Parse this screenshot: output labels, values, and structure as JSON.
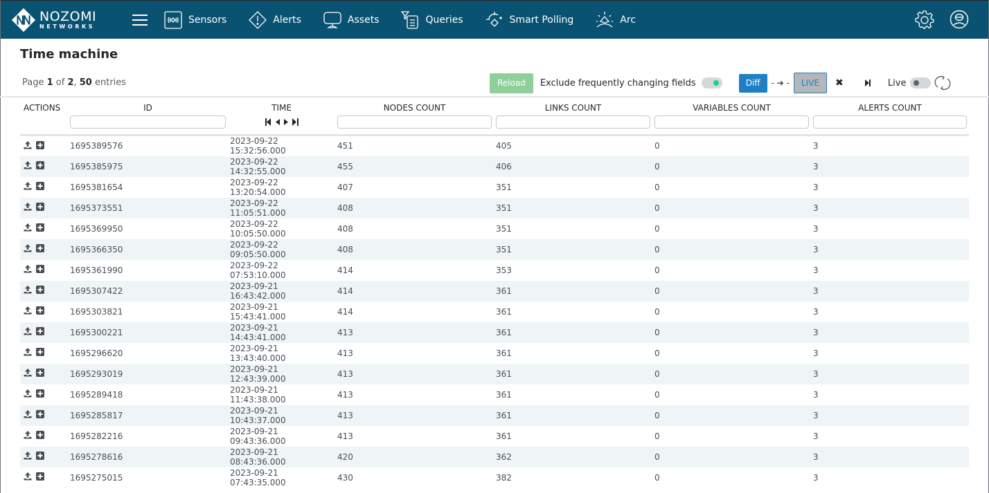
{
  "brand": {
    "name": "NOZOMI",
    "sub": "NETWORKS"
  },
  "nav": [
    {
      "label": "Sensors",
      "icon": "sensors-icon"
    },
    {
      "label": "Alerts",
      "icon": "alert-icon"
    },
    {
      "label": "Assets",
      "icon": "monitor-icon"
    },
    {
      "label": "Queries",
      "icon": "queries-icon"
    },
    {
      "label": "Smart Polling",
      "icon": "smart-polling-icon"
    },
    {
      "label": "Arc",
      "icon": "arc-icon"
    }
  ],
  "page": {
    "title": "Time machine",
    "page_prefix": "Page ",
    "page_current": "1",
    "page_of": " of ",
    "page_total": "2",
    "page_sep": ", ",
    "entries": "50",
    "entries_suffix": " entries"
  },
  "toolbar": {
    "reload_label": "Reload",
    "exclude_label": "Exclude frequently changing fields",
    "exclude_on": true,
    "diff_label": "Diff",
    "arrow_text": "- ➔ -",
    "live_button_label": "LIVE",
    "live_label": "Live",
    "live_on": false
  },
  "table": {
    "columns": [
      "ACTIONS",
      "ID",
      "TIME",
      "NODES COUNT",
      "LINKS COUNT",
      "VARIABLES COUNT",
      "ALERTS COUNT"
    ],
    "rows": [
      {
        "id": "1695389576",
        "time": "2023-09-22 15:32:56.000",
        "nodes": "451",
        "links": "405",
        "variables": "0",
        "alerts": "3"
      },
      {
        "id": "1695385975",
        "time": "2023-09-22 14:32:55.000",
        "nodes": "455",
        "links": "406",
        "variables": "0",
        "alerts": "3"
      },
      {
        "id": "1695381654",
        "time": "2023-09-22 13:20:54.000",
        "nodes": "407",
        "links": "351",
        "variables": "0",
        "alerts": "3"
      },
      {
        "id": "1695373551",
        "time": "2023-09-22 11:05:51.000",
        "nodes": "408",
        "links": "351",
        "variables": "0",
        "alerts": "3"
      },
      {
        "id": "1695369950",
        "time": "2023-09-22 10:05:50.000",
        "nodes": "408",
        "links": "351",
        "variables": "0",
        "alerts": "3"
      },
      {
        "id": "1695366350",
        "time": "2023-09-22 09:05:50.000",
        "nodes": "408",
        "links": "351",
        "variables": "0",
        "alerts": "3"
      },
      {
        "id": "1695361990",
        "time": "2023-09-22 07:53:10.000",
        "nodes": "414",
        "links": "353",
        "variables": "0",
        "alerts": "3"
      },
      {
        "id": "1695307422",
        "time": "2023-09-21 16:43:42.000",
        "nodes": "414",
        "links": "361",
        "variables": "0",
        "alerts": "3"
      },
      {
        "id": "1695303821",
        "time": "2023-09-21 15:43:41.000",
        "nodes": "414",
        "links": "361",
        "variables": "0",
        "alerts": "3"
      },
      {
        "id": "1695300221",
        "time": "2023-09-21 14:43:41.000",
        "nodes": "413",
        "links": "361",
        "variables": "0",
        "alerts": "3"
      },
      {
        "id": "1695296620",
        "time": "2023-09-21 13:43:40.000",
        "nodes": "413",
        "links": "361",
        "variables": "0",
        "alerts": "3"
      },
      {
        "id": "1695293019",
        "time": "2023-09-21 12:43:39.000",
        "nodes": "413",
        "links": "361",
        "variables": "0",
        "alerts": "3"
      },
      {
        "id": "1695289418",
        "time": "2023-09-21 11:43:38.000",
        "nodes": "413",
        "links": "361",
        "variables": "0",
        "alerts": "3"
      },
      {
        "id": "1695285817",
        "time": "2023-09-21 10:43:37.000",
        "nodes": "413",
        "links": "361",
        "variables": "0",
        "alerts": "3"
      },
      {
        "id": "1695282216",
        "time": "2023-09-21 09:43:36.000",
        "nodes": "413",
        "links": "361",
        "variables": "0",
        "alerts": "3"
      },
      {
        "id": "1695278616",
        "time": "2023-09-21 08:43:36.000",
        "nodes": "420",
        "links": "362",
        "variables": "0",
        "alerts": "3"
      },
      {
        "id": "1695275015",
        "time": "2023-09-21 07:43:35.000",
        "nodes": "430",
        "links": "382",
        "variables": "0",
        "alerts": "3"
      }
    ]
  },
  "colors": {
    "topbar": "#0a5272",
    "diff": "#1f7fc4",
    "reload": "#8fcf9a",
    "toggle_on": "#19d18c"
  }
}
